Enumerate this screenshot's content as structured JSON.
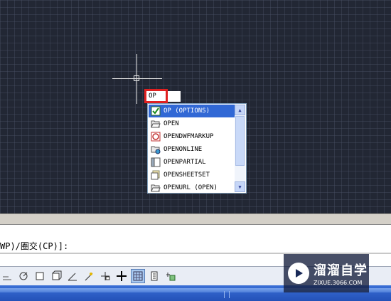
{
  "command_input": {
    "value": "OP"
  },
  "autocomplete": {
    "items": [
      {
        "label": "OP (OPTIONS)",
        "icon": "checkbox-icon",
        "selected": true
      },
      {
        "label": "OPEN",
        "icon": "folder-open-icon",
        "selected": false
      },
      {
        "label": "OPENDWFMARKUP",
        "icon": "markup-icon",
        "selected": false
      },
      {
        "label": "OPENONLINE",
        "icon": "folder-online-icon",
        "selected": false
      },
      {
        "label": "OPENPARTIAL",
        "icon": "partial-open-icon",
        "selected": false
      },
      {
        "label": "OPENSHEETSET",
        "icon": "sheetset-icon",
        "selected": false
      },
      {
        "label": "OPENURL (OPEN)",
        "icon": "folder-open-icon",
        "selected": false
      }
    ]
  },
  "command_line": {
    "text": "WP)/圈交(CP)]:"
  },
  "watermark": {
    "title": "溜溜自学",
    "url": "ZIXUE.3066.COM"
  },
  "colors": {
    "canvas": "#222734",
    "selection": "#3168d5",
    "highlight": "#e02020"
  }
}
